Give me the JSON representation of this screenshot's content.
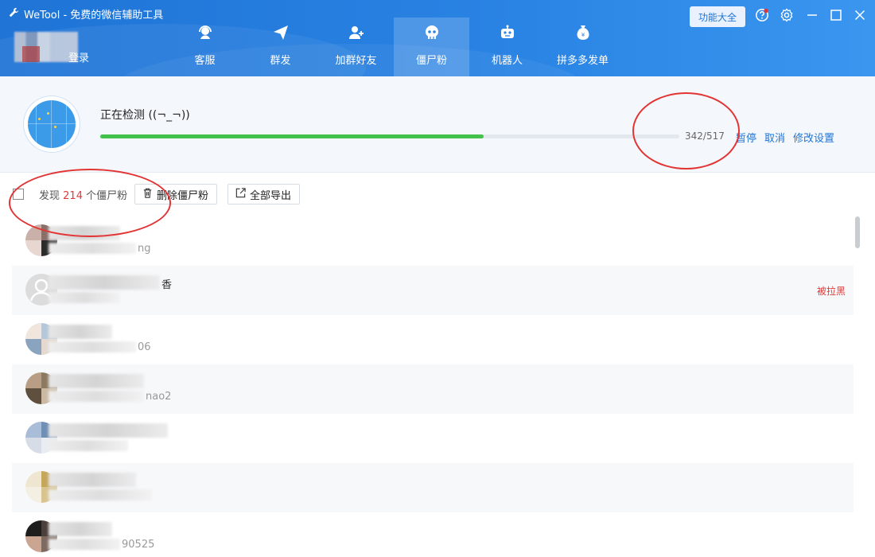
{
  "window": {
    "title": "WeTool - 免费的微信辅助工具"
  },
  "account": {
    "login_label": "登录"
  },
  "nav": {
    "items": [
      {
        "label": "客服",
        "icon": "headset-icon",
        "active": false
      },
      {
        "label": "群发",
        "icon": "send-icon",
        "active": false
      },
      {
        "label": "加群好友",
        "icon": "add-friend-icon",
        "active": false
      },
      {
        "label": "僵尸粉",
        "icon": "skull-icon",
        "active": true
      },
      {
        "label": "机器人",
        "icon": "robot-icon",
        "active": false
      },
      {
        "label": "拼多多发单",
        "icon": "money-bag-icon",
        "active": false
      }
    ]
  },
  "header_actions": {
    "features_label": "功能大全"
  },
  "scan": {
    "title": "正在检测 ((¬_¬))",
    "progress_text": "342/517",
    "progress_value": 0.6615,
    "pause_label": "暂停",
    "cancel_label": "取消",
    "settings_label": "修改设置"
  },
  "toolbar": {
    "found_prefix": "发现",
    "found_count": "214",
    "found_suffix": "个僵尸粉",
    "delete_label": "删除僵尸粉",
    "export_label": "全部导出"
  },
  "contacts": [
    {
      "name_fragment": "",
      "sub_fragment": "ng",
      "status": ""
    },
    {
      "name_fragment": "香",
      "sub_fragment": "",
      "status": "被拉黑"
    },
    {
      "name_fragment": "",
      "sub_fragment": "06",
      "status": ""
    },
    {
      "name_fragment": "",
      "sub_fragment": "nao2",
      "status": ""
    },
    {
      "name_fragment": "",
      "sub_fragment": "",
      "status": ""
    },
    {
      "name_fragment": "",
      "sub_fragment": "",
      "status": ""
    },
    {
      "name_fragment": "",
      "sub_fragment": "90525",
      "status": ""
    }
  ],
  "colors": {
    "brand": "#1f74d6",
    "progress": "#43c24b",
    "alert": "#e03b3b",
    "annotation": "#e23434"
  }
}
